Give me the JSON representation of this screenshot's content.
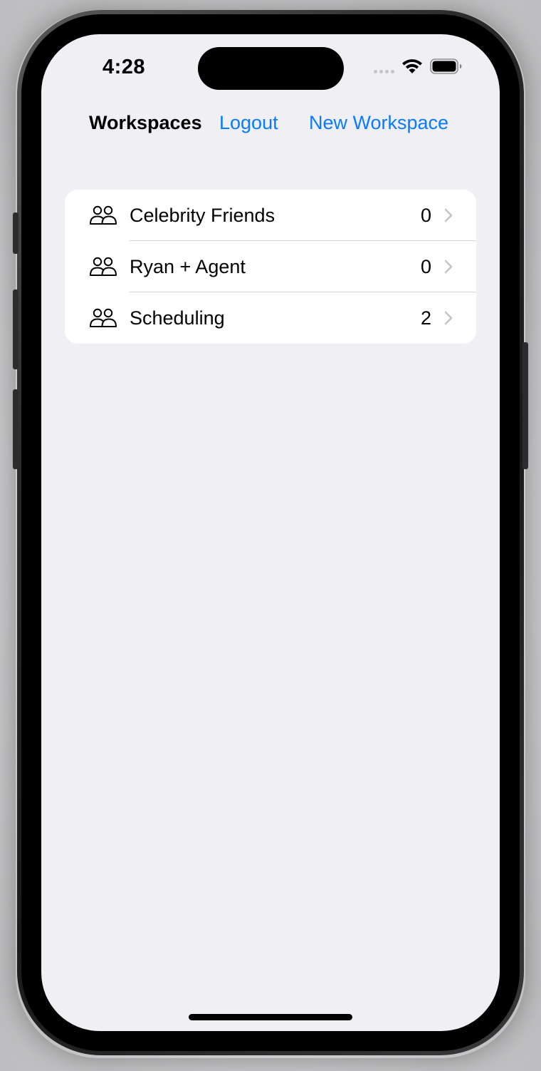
{
  "status_bar": {
    "time": "4:28",
    "icons": [
      "signal-dots-icon",
      "wifi-icon",
      "battery-icon"
    ]
  },
  "nav": {
    "title": "Workspaces",
    "logout_label": "Logout",
    "new_workspace_label": "New Workspace"
  },
  "workspaces": [
    {
      "name": "Celebrity Friends",
      "count": "0",
      "icon": "people-icon"
    },
    {
      "name": "Ryan + Agent",
      "count": "0",
      "icon": "people-icon"
    },
    {
      "name": "Scheduling",
      "count": "2",
      "icon": "people-icon"
    }
  ],
  "colors": {
    "accent": "#0a7aff",
    "background": "#efeff4",
    "card": "#ffffff",
    "separator": "#d1d1d6",
    "chevron": "#c4c4c7"
  }
}
